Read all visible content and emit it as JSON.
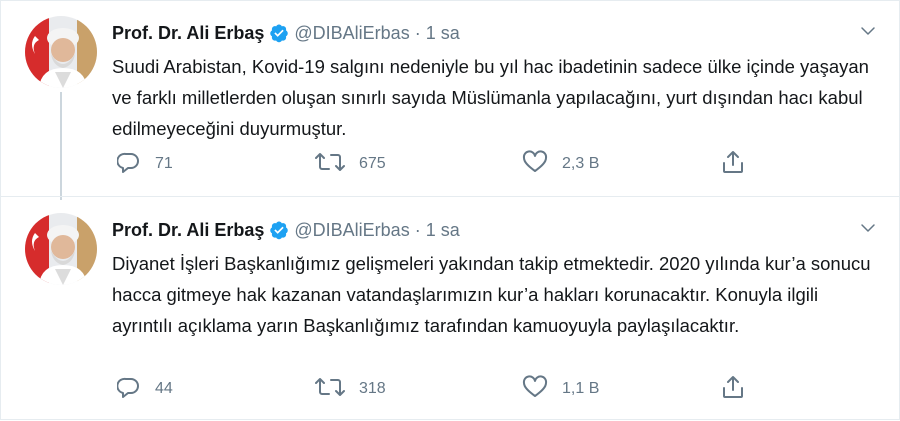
{
  "tweets": [
    {
      "author": {
        "name": "Prof. Dr. Ali Erbaş",
        "handle": "@DIBAliErbas",
        "verified": true
      },
      "time": "1 sa",
      "separator": "·",
      "text": "Suudi Arabistan, Kovid-19 salgını nedeniyle bu yıl hac ibadetinin sadece ülke içinde yaşayan ve farklı milletlerden oluşan sınırlı sayıda Müslümanla yapılacağını, yurt dışından hacı kabul edilmeyeceğini duyurmuştur.",
      "stats": {
        "replies": "71",
        "retweets": "675",
        "likes": "2,3 B"
      }
    },
    {
      "author": {
        "name": "Prof. Dr. Ali Erbaş",
        "handle": "@DIBAliErbas",
        "verified": true
      },
      "time": "1 sa",
      "separator": "·",
      "text": "Diyanet İşleri Başkanlığımız gelişmeleri yakından takip etmektedir. 2020 yılında kur’a sonucu hacca gitmeye hak kazanan vatandaşlarımızın kur’a hakları korunacaktır. Konuyla ilgili ayrıntılı açıklama yarın Başkanlığımız tarafından kamuoyuyla paylaşılacaktır.",
      "stats": {
        "replies": "44",
        "retweets": "318",
        "likes": "1,1 B"
      }
    }
  ],
  "icons": {
    "verified": "verified-badge-icon",
    "caret": "chevron-down-icon",
    "reply": "reply-icon",
    "retweet": "retweet-icon",
    "like": "heart-icon",
    "share": "share-icon"
  },
  "colors": {
    "verified": "#1da1f2",
    "muted": "#657786",
    "text": "#14171a",
    "divider": "#e6ecf0",
    "thread_line": "#ccd6dd"
  }
}
